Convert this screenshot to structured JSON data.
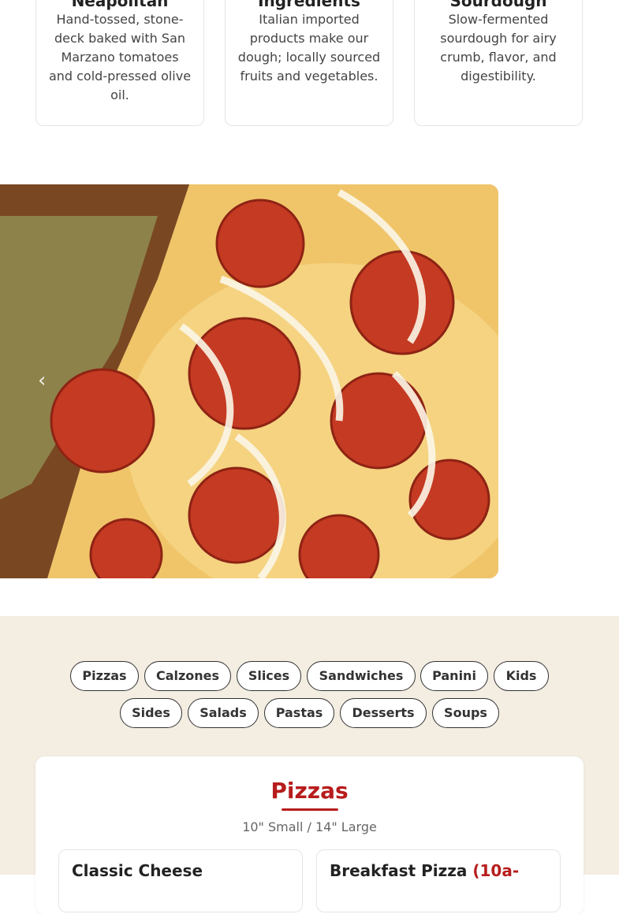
{
  "features": [
    {
      "title": "Neapolitan",
      "description": "Hand-tossed, stone-deck baked with San Marzano tomatoes and cold-pressed olive oil."
    },
    {
      "title": "Ingredients",
      "description": "Italian imported products make our dough; locally sourced fruits and vegetables."
    },
    {
      "title": "Sourdough",
      "description": "Slow-fermented sourdough for airy crumb, flavor, and digestibility."
    }
  ],
  "gallery": {
    "image_subject": "pepperoni and onion pizza close-up",
    "prev_icon": "chevron-left-icon"
  },
  "categories": [
    "Pizzas",
    "Calzones",
    "Slices",
    "Sandwiches",
    "Panini",
    "Kids",
    "Sides",
    "Salads",
    "Pastas",
    "Desserts",
    "Soups"
  ],
  "menu": {
    "title": "Pizzas",
    "subtitle": "10\" Small / 14\" Large",
    "items": [
      {
        "name": "Classic Cheese",
        "note": ""
      },
      {
        "name": "Breakfast Pizza",
        "note": "(10a-"
      }
    ]
  },
  "colors": {
    "accent": "#b71c1c",
    "section_bg": "#f3ede2"
  }
}
